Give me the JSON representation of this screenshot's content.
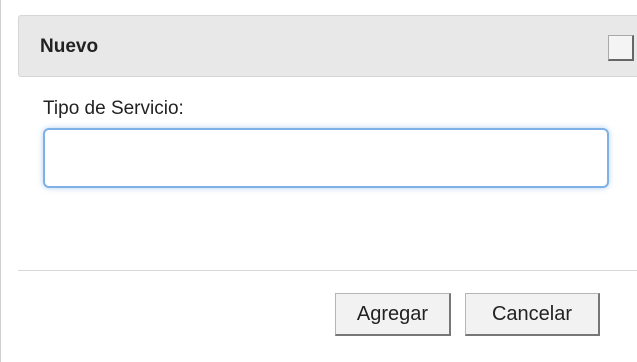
{
  "dialog": {
    "title": "Nuevo",
    "close_button_label": ""
  },
  "form": {
    "field_label": "Tipo de Servicio:",
    "field_value": "",
    "field_placeholder": ""
  },
  "actions": {
    "add_label": "Agregar",
    "cancel_label": "Cancelar"
  },
  "colors": {
    "titlebar_bg": "#e8e8e8",
    "focus_border": "#7fb1e6",
    "button_bg": "#f2f2f2"
  }
}
